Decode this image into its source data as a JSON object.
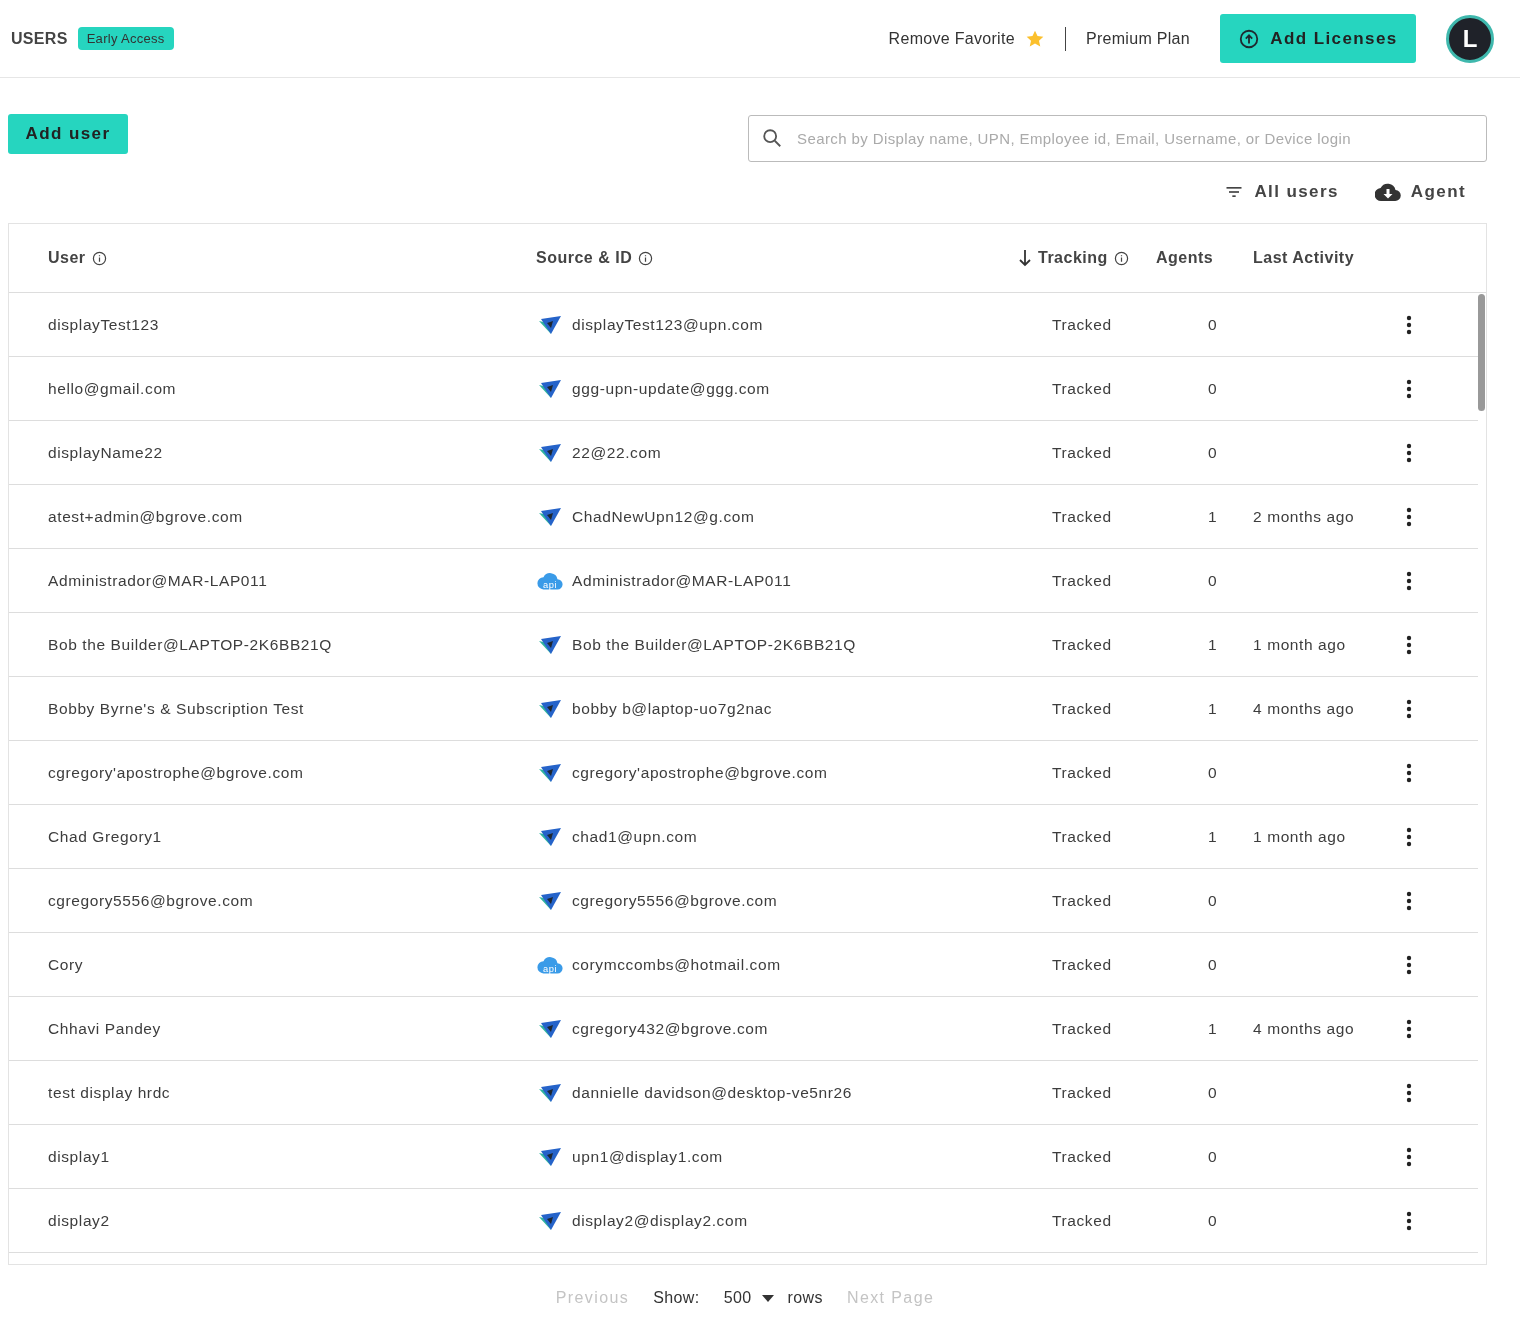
{
  "header": {
    "title": "USERS",
    "badge": "Early Access",
    "favorite": {
      "label": "Remove Favorite",
      "on": true
    },
    "plan": "Premium Plan",
    "add_licenses": "Add Licenses",
    "avatar": "L"
  },
  "toolbar": {
    "add_user": "Add user",
    "search": {
      "placeholder": "Search by Display name, UPN, Employee id, Email, Username, or Device login"
    },
    "filter": "All users",
    "agent": "Agent"
  },
  "table": {
    "columns": [
      {
        "label": "User",
        "info": true,
        "sorted": false
      },
      {
        "label": "Source & ID",
        "info": true,
        "sorted": false
      },
      {
        "label": "Tracking",
        "info": true,
        "sorted": true
      },
      {
        "label": "Agents",
        "info": false,
        "sorted": false
      },
      {
        "label": "Last Activity",
        "info": false,
        "sorted": false
      }
    ],
    "rows": [
      {
        "user": "displayTest123",
        "kind": "agent",
        "id": "displayTest123@upn.com",
        "tracking": "Tracked",
        "agents": "0"
      },
      {
        "user": "hello@gmail.com",
        "kind": "agent",
        "id": "ggg-upn-update@ggg.com",
        "tracking": "Tracked",
        "agents": "0"
      },
      {
        "user": "displayName22",
        "kind": "agent",
        "id": "22@22.com",
        "tracking": "Tracked",
        "agents": "0"
      },
      {
        "user": "atest+admin@bgrove.com",
        "kind": "agent",
        "id": "ChadNewUpn12@g.com",
        "tracking": "Tracked",
        "agents": "1",
        "last_activity": "2 months ago"
      },
      {
        "user": "Administrador@MAR-LAP011",
        "kind": "api",
        "source_badge": "api",
        "id": "Administrador@MAR-LAP011",
        "tracking": "Tracked",
        "agents": "0"
      },
      {
        "user": "Bob the Builder@LAPTOP-2K6BB21Q",
        "kind": "agent",
        "id": "Bob the Builder@LAPTOP-2K6BB21Q",
        "tracking": "Tracked",
        "agents": "1",
        "last_activity": "1 month ago"
      },
      {
        "user": "Bobby Byrne's & Subscription Test",
        "kind": "agent",
        "id": "bobby b@laptop-uo7g2nac",
        "tracking": "Tracked",
        "agents": "1",
        "last_activity": "4 months ago"
      },
      {
        "user": "cgregory'apostrophe@bgrove.com",
        "kind": "agent",
        "id": "cgregory'apostrophe@bgrove.com",
        "tracking": "Tracked",
        "agents": "0"
      },
      {
        "user": "Chad Gregory1",
        "kind": "agent",
        "id": "chad1@upn.com",
        "tracking": "Tracked",
        "agents": "1",
        "last_activity": "1 month ago"
      },
      {
        "user": "cgregory5556@bgrove.com",
        "kind": "agent",
        "id": "cgregory5556@bgrove.com",
        "tracking": "Tracked",
        "agents": "0"
      },
      {
        "user": "Cory",
        "kind": "api",
        "source_badge": "api",
        "id": "corymccombs@hotmail.com",
        "tracking": "Tracked",
        "agents": "0"
      },
      {
        "user": "Chhavi Pandey",
        "kind": "agent",
        "id": "cgregory432@bgrove.com",
        "tracking": "Tracked",
        "agents": "1",
        "last_activity": "4 months ago"
      },
      {
        "user": "test display hrdc",
        "kind": "agent",
        "id": "dannielle davidson@desktop-ve5nr26",
        "tracking": "Tracked",
        "agents": "0"
      },
      {
        "user": "display1",
        "kind": "agent",
        "id": "upn1@display1.com",
        "tracking": "Tracked",
        "agents": "0"
      },
      {
        "user": "display2",
        "kind": "agent",
        "id": "display2@display2.com",
        "tracking": "Tracked",
        "agents": "0"
      }
    ]
  },
  "pagination": {
    "previous": {
      "label": "Previous",
      "disabled": true
    },
    "show_label": "Show:",
    "rows_per_page": "500",
    "rows_label": "rows",
    "next": {
      "label": "Next Page",
      "disabled": true
    }
  }
}
